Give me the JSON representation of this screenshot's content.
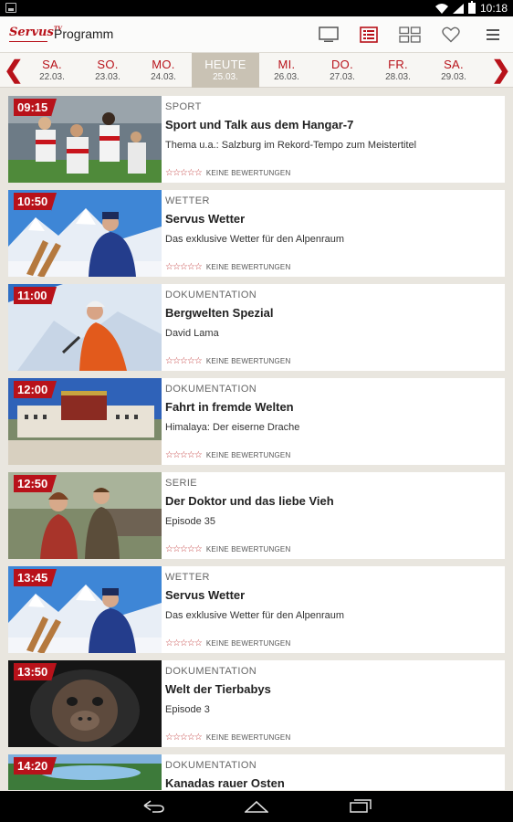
{
  "status": {
    "time": "10:18"
  },
  "header": {
    "logo_text": "Servus",
    "logo_suffix": "TV",
    "title": "Programm",
    "actions": [
      {
        "icon": "tv-icon"
      },
      {
        "icon": "list-view-icon"
      },
      {
        "icon": "grid-view-icon"
      },
      {
        "icon": "heart-icon"
      },
      {
        "icon": "menu-icon"
      }
    ]
  },
  "datebar": {
    "prev_arrow": "❮",
    "next_arrow": "❯",
    "days": [
      {
        "name": "SA.",
        "date": "22.03."
      },
      {
        "name": "SO.",
        "date": "23.03."
      },
      {
        "name": "MO.",
        "date": "24.03."
      },
      {
        "name": "HEUTE",
        "date": "25.03.",
        "active": true
      },
      {
        "name": "MI.",
        "date": "26.03."
      },
      {
        "name": "DO.",
        "date": "27.03."
      },
      {
        "name": "FR.",
        "date": "28.03."
      },
      {
        "name": "SA.",
        "date": "29.03."
      }
    ]
  },
  "rating_label": "KEINE BEWERTUNGEN",
  "rating_stars": "☆☆☆☆☆",
  "programs": [
    {
      "time": "09:15",
      "category": "SPORT",
      "title": "Sport und Talk aus dem Hangar-7",
      "subtitle": "Thema u.a.: Salzburg im Rekord-Tempo zum Meistertitel",
      "thumb": "football-team"
    },
    {
      "time": "10:50",
      "category": "WETTER",
      "title": "Servus Wetter",
      "subtitle": "Das exklusive Wetter für den Alpenraum",
      "thumb": "weather-mountain"
    },
    {
      "time": "11:00",
      "category": "DOKUMENTATION",
      "title": "Bergwelten Spezial",
      "subtitle": "David Lama",
      "thumb": "climber"
    },
    {
      "time": "12:00",
      "category": "DOKUMENTATION",
      "title": "Fahrt in fremde Welten",
      "subtitle": "Himalaya: Der eiserne Drache",
      "thumb": "palace"
    },
    {
      "time": "12:50",
      "category": "SERIE",
      "title": "Der Doktor und das liebe Vieh",
      "subtitle": "Episode 35",
      "thumb": "couple"
    },
    {
      "time": "13:45",
      "category": "WETTER",
      "title": "Servus Wetter",
      "subtitle": "Das exklusive Wetter für den Alpenraum",
      "thumb": "weather-mountain"
    },
    {
      "time": "13:50",
      "category": "DOKUMENTATION",
      "title": "Welt der Tierbabys",
      "subtitle": "Episode 3",
      "thumb": "ape"
    },
    {
      "time": "14:20",
      "category": "DOKUMENTATION",
      "title": "Kanadas rauer Osten",
      "subtitle": "",
      "thumb": "lake"
    }
  ],
  "colors": {
    "accent": "#b8121a",
    "background": "#e9e6df",
    "active_day": "#c9c2b4"
  }
}
